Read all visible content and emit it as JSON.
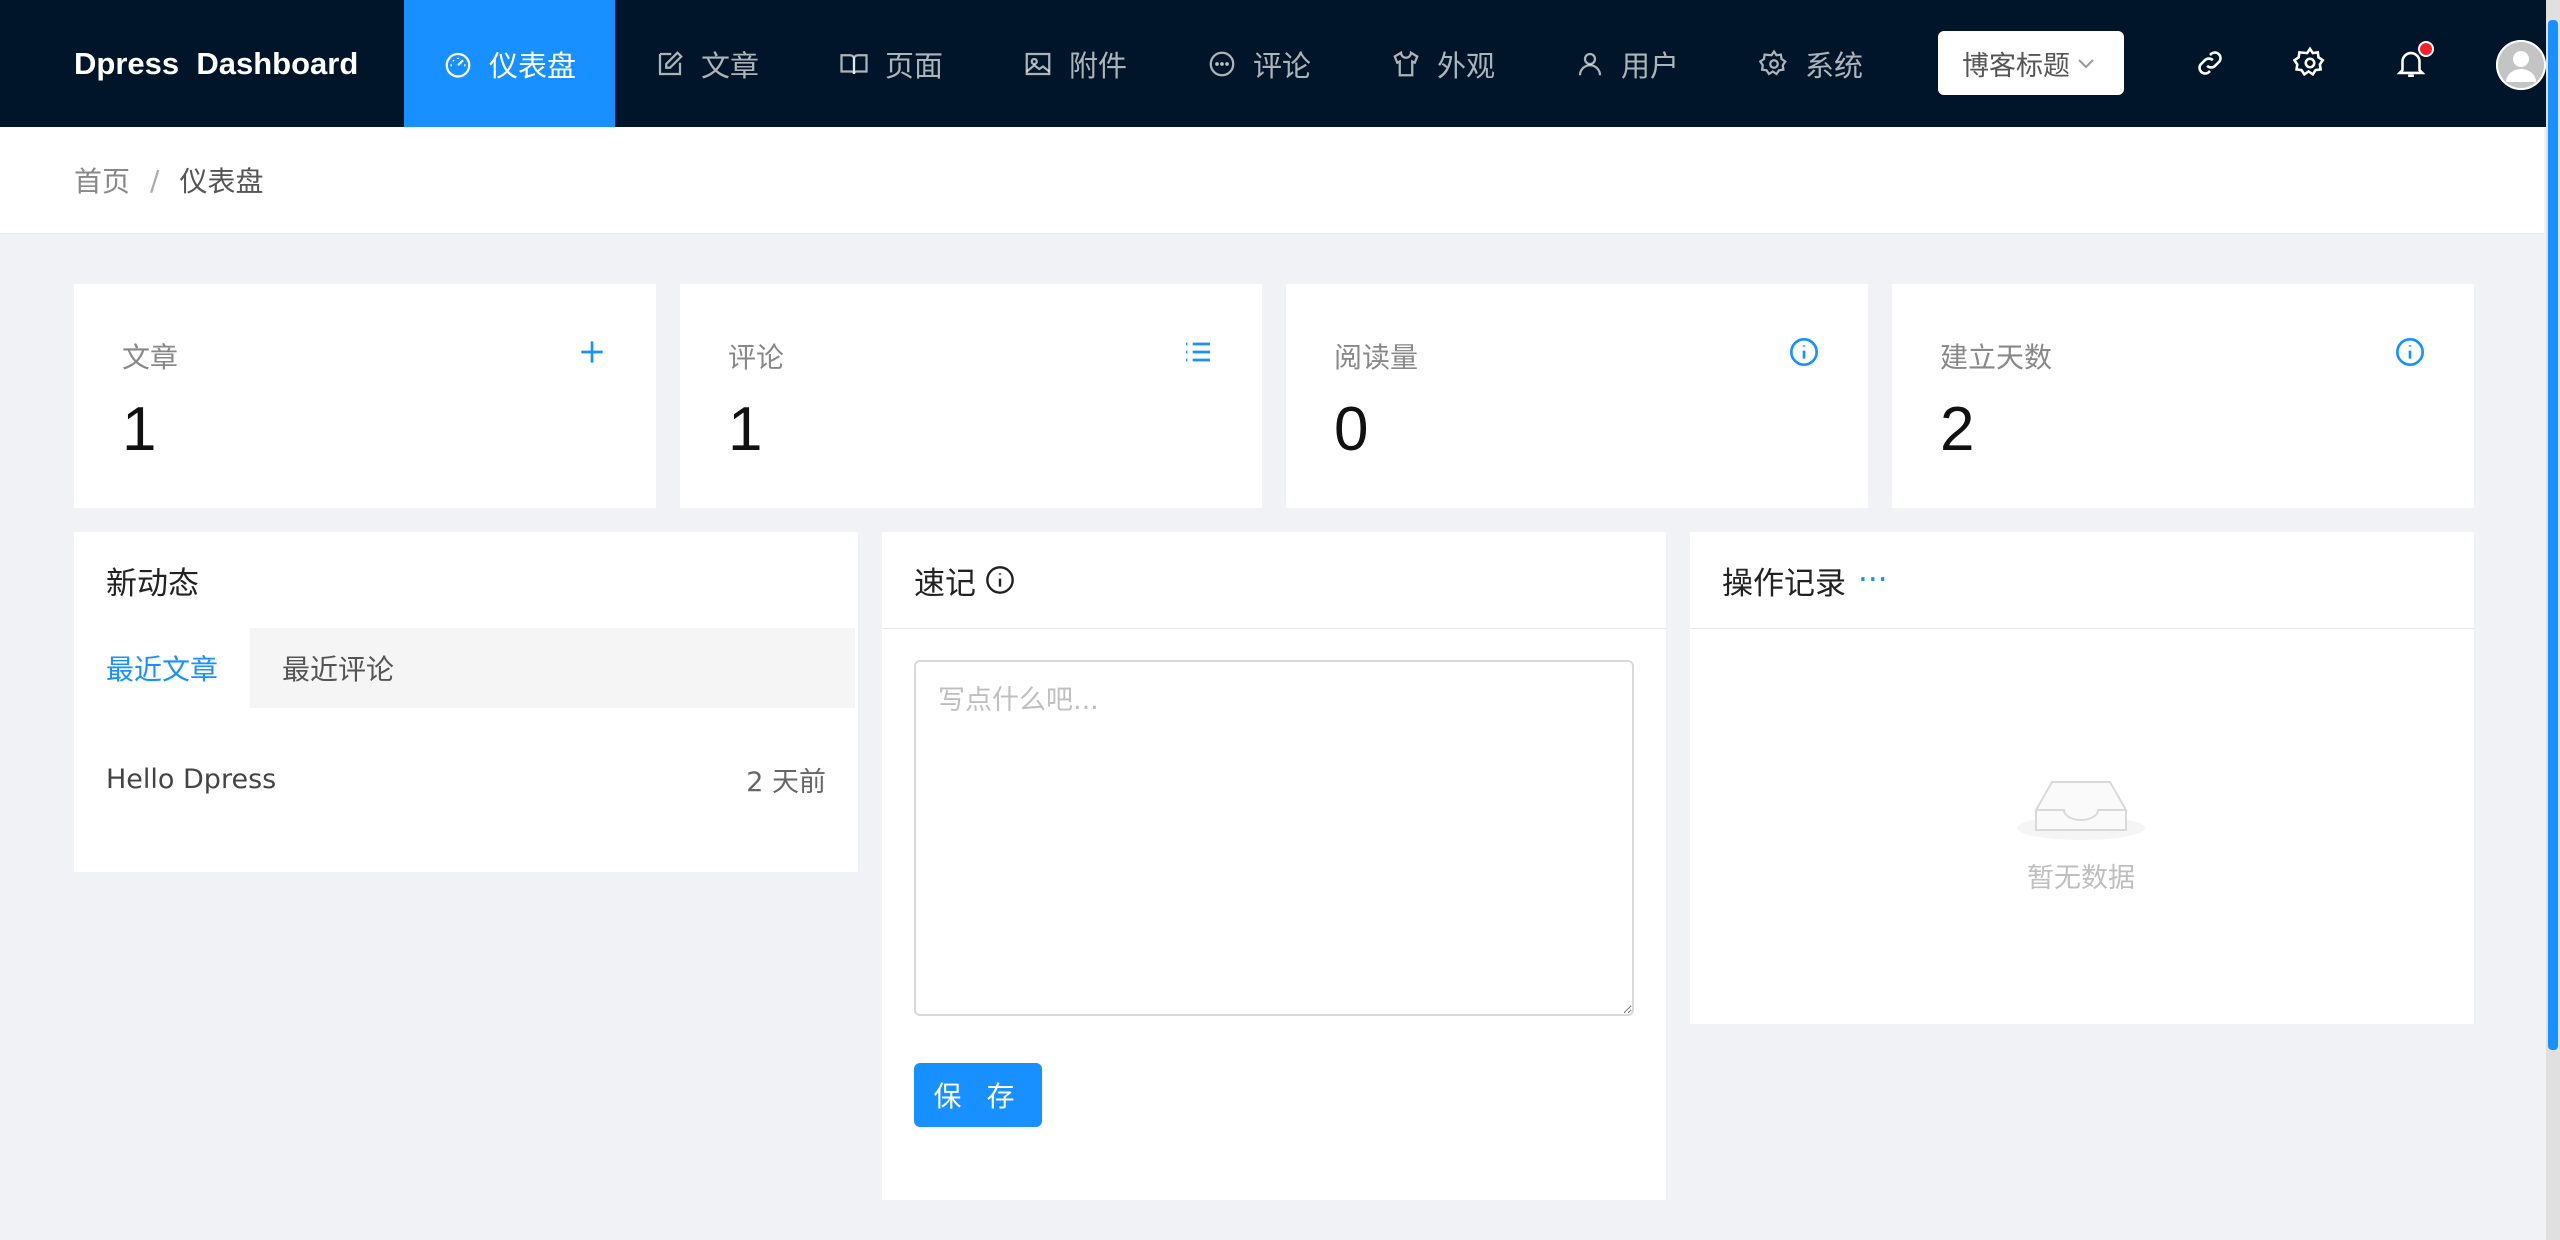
{
  "app": {
    "brand": "Dpress  Dashboard"
  },
  "nav": {
    "items": [
      {
        "label": "仪表盘",
        "icon": "dashboard-icon",
        "active": true
      },
      {
        "label": "文章",
        "icon": "edit-icon"
      },
      {
        "label": "页面",
        "icon": "book-icon"
      },
      {
        "label": "附件",
        "icon": "picture-icon"
      },
      {
        "label": "评论",
        "icon": "message-icon"
      },
      {
        "label": "外观",
        "icon": "skin-icon"
      },
      {
        "label": "用户",
        "icon": "user-icon"
      },
      {
        "label": "系统",
        "icon": "setting-icon"
      }
    ],
    "blog_select": "博客标题",
    "link_icon": "link-icon",
    "settings_icon": "gear-icon",
    "notification_icon": "bell-icon"
  },
  "breadcrumb": {
    "home": "首页",
    "separator": "/",
    "current": "仪表盘"
  },
  "stats": [
    {
      "title": "文章",
      "value": "1",
      "icon": "plus-icon"
    },
    {
      "title": "评论",
      "value": "1",
      "icon": "list-icon"
    },
    {
      "title": "阅读量",
      "value": "0",
      "icon": "info-icon"
    },
    {
      "title": "建立天数",
      "value": "2",
      "icon": "info-icon"
    }
  ],
  "activity": {
    "title": "新动态",
    "tabs": [
      "最近文章",
      "最近评论"
    ],
    "articles": [
      {
        "title": "Hello Dpress",
        "time": "2 天前"
      }
    ]
  },
  "notes": {
    "title": "速记",
    "placeholder": "写点什么吧...",
    "save_label": "保 存"
  },
  "log": {
    "title": "操作记录",
    "more": "···",
    "empty_text": "暂无数据"
  },
  "colors": {
    "nav_bg": "#001529",
    "accent": "#1890ff",
    "page_bg": "#f0f2f5",
    "badge": "#f5222d"
  }
}
